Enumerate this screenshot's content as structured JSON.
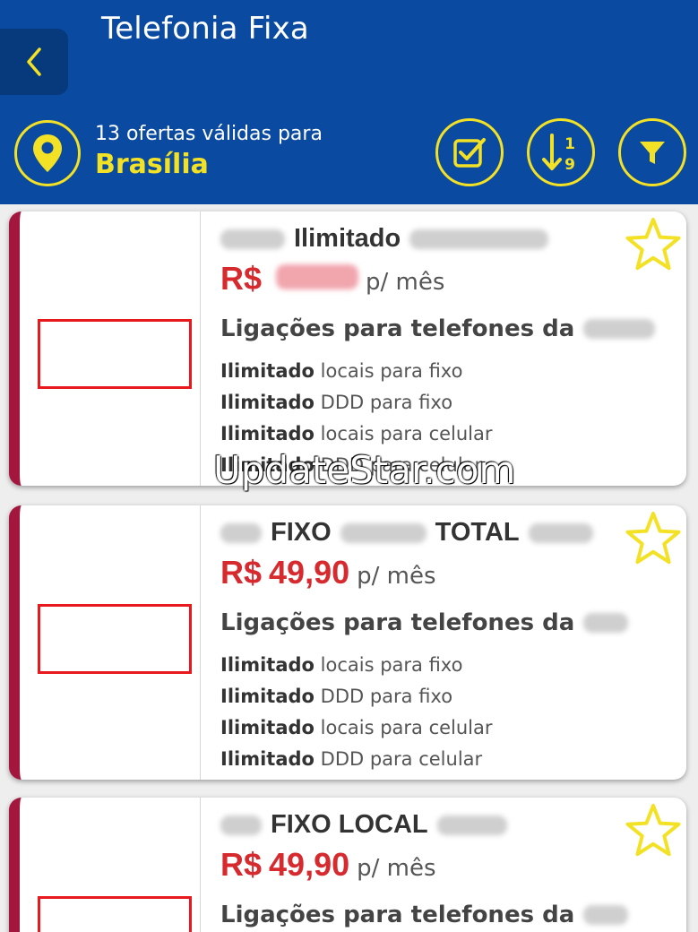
{
  "header": {
    "title": "Telefonia Fixa",
    "offers_text": "13 ofertas válidas para",
    "city": "Brasília",
    "icons": {
      "back": "chevron-left-icon",
      "location": "location-pin-icon",
      "compare": "checkbox-icon",
      "sort": "sort-numeric-icon",
      "filter": "funnel-icon"
    },
    "sort_digits": {
      "top": "1",
      "bottom": "9"
    }
  },
  "colors": {
    "header_bg": "#0a4aa0",
    "accent_yellow": "#f3e125",
    "price_red": "#d62a2f",
    "card_stripe": "#a3173f"
  },
  "cards": [
    {
      "name_visible": "Ilimitado",
      "currency": "R$",
      "price": "",
      "per": "p/ mês",
      "calls_prefix": "Ligações para telefones da",
      "features": [
        {
          "bold": "Ilimitado",
          "rest": " locais para fixo"
        },
        {
          "bold": "Ilimitado",
          "rest": " DDD para fixo"
        },
        {
          "bold": "Ilimitado",
          "rest": " locais para celular"
        },
        {
          "bold": "Ilimitado",
          "rest": " DDD para celular"
        }
      ]
    },
    {
      "name_part1": "FIXO",
      "name_part2": "TOTAL",
      "currency": "R$",
      "price": "49,90",
      "per": "p/ mês",
      "calls_prefix": "Ligações para telefones da",
      "features": [
        {
          "bold": "Ilimitado",
          "rest": " locais para fixo"
        },
        {
          "bold": "Ilimitado",
          "rest": " DDD para fixo"
        },
        {
          "bold": "Ilimitado",
          "rest": " locais para celular"
        },
        {
          "bold": "Ilimitado",
          "rest": " DDD para celular"
        }
      ]
    },
    {
      "name_visible": "FIXO LOCAL",
      "currency": "R$",
      "price": "49,90",
      "per": "p/ mês",
      "calls_prefix": "Ligações para telefones da"
    }
  ],
  "watermark": "UpdateStar.com"
}
